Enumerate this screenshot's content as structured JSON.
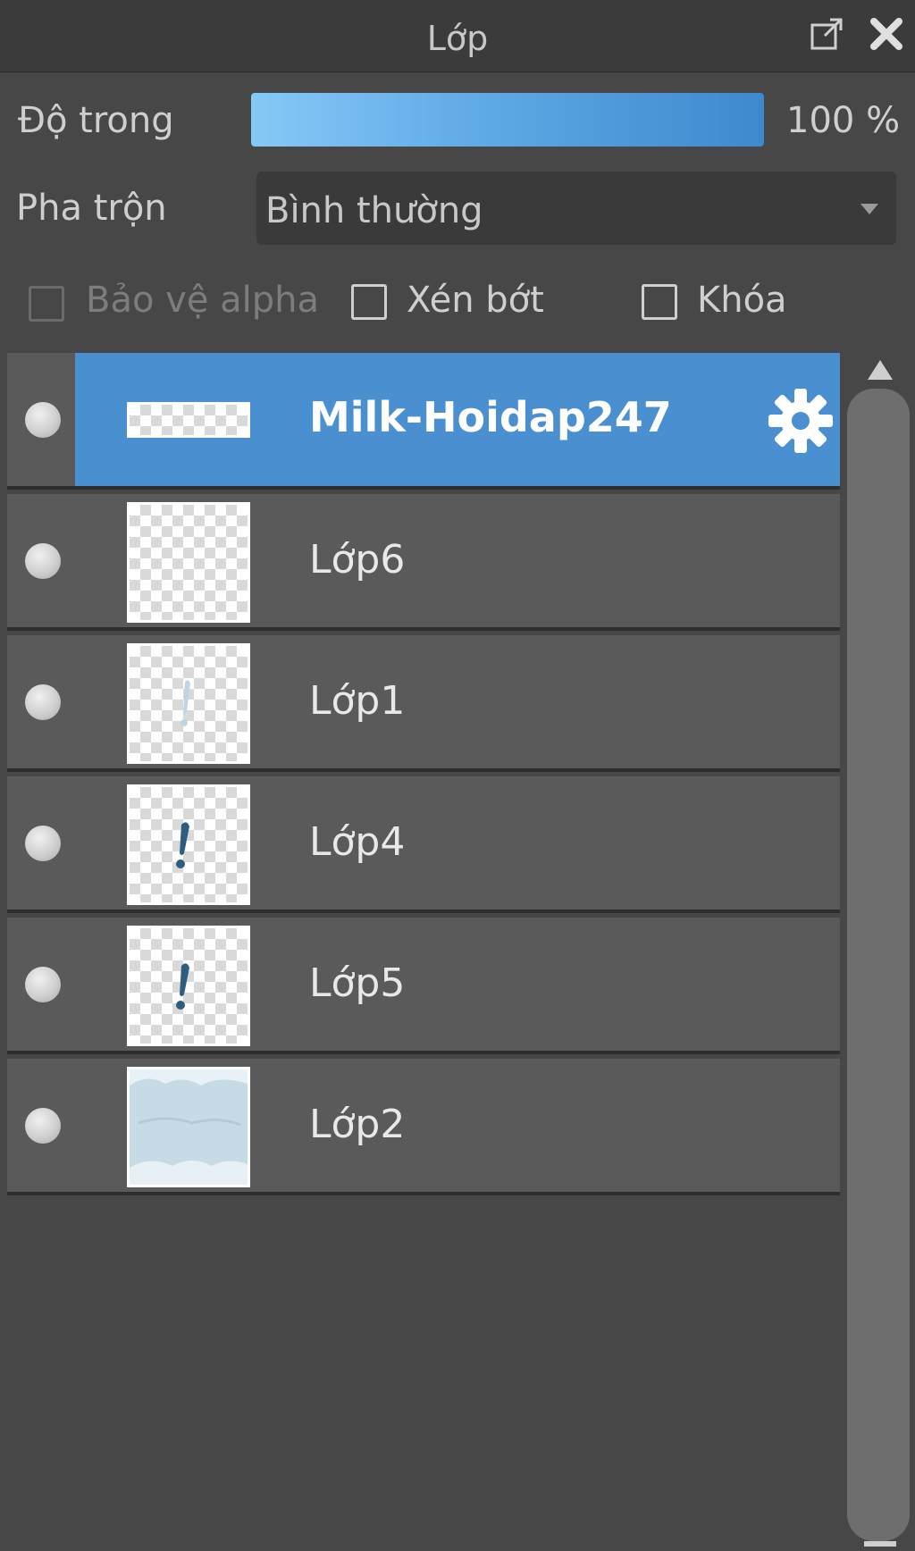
{
  "window": {
    "title": "Lớp"
  },
  "opacity": {
    "label": "Độ trong",
    "value_text": "100 %",
    "value": 1.0
  },
  "blend": {
    "label": "Pha trộn",
    "value": "Bình thường"
  },
  "options": {
    "protect_alpha": {
      "label": "Bảo vệ alpha",
      "checked": false,
      "enabled": false
    },
    "clipping": {
      "label": "Xén bớt",
      "checked": false,
      "enabled": true
    },
    "lock": {
      "label": "Khóa",
      "checked": false,
      "enabled": true
    }
  },
  "layers": [
    {
      "name": "Milk-Hoidap247",
      "selected": true,
      "thumb": "text-banner"
    },
    {
      "name": "Lớp6",
      "selected": false,
      "thumb": "empty"
    },
    {
      "name": "Lớp1",
      "selected": false,
      "thumb": "faint-mark"
    },
    {
      "name": "Lớp4",
      "selected": false,
      "thumb": "exclamation"
    },
    {
      "name": "Lớp5",
      "selected": false,
      "thumb": "exclamation"
    },
    {
      "name": "Lớp2",
      "selected": false,
      "thumb": "sky-clouds"
    }
  ],
  "icons": {
    "popout": "popout-icon",
    "close": "close-icon",
    "gear": "gear-icon",
    "dropdown": "chevron-down-icon"
  },
  "colors": {
    "accent": "#4a8fcf",
    "panel": "#474747",
    "row": "#5a5a5a"
  }
}
